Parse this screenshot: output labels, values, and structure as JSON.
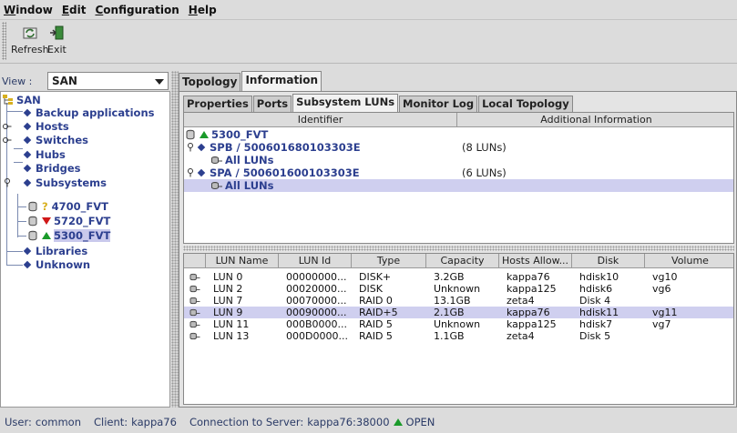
{
  "menu": {
    "items": [
      "Window",
      "Edit",
      "Configuration",
      "Help"
    ],
    "mnemonics": [
      "W",
      "E",
      "C",
      "H"
    ]
  },
  "toolbar": {
    "refresh_label": "Refresh",
    "exit_label": "Exit"
  },
  "view": {
    "label": "View :",
    "selected": "SAN"
  },
  "tree": {
    "root": "SAN",
    "items": [
      "Backup applications",
      "Hosts",
      "Switches",
      "Hubs",
      "Bridges",
      "Subsystems",
      "Libraries",
      "Unknown"
    ],
    "subsystems": [
      {
        "name": "4700_FVT",
        "status": "unknown"
      },
      {
        "name": "5720_FVT",
        "status": "down"
      },
      {
        "name": "5300_FVT",
        "status": "up"
      }
    ]
  },
  "outer_tabs": [
    "Topology",
    "Information"
  ],
  "inner_tabs": [
    "Properties",
    "Ports",
    "Subsystem LUNs",
    "Monitor Log",
    "Local Topology"
  ],
  "upper_table": {
    "headers": [
      "Identifier",
      "Additional Information"
    ],
    "subsystem": "5300_FVT",
    "controllers": [
      {
        "label": "SPB / 500601680103303E",
        "info": "(8 LUNs)",
        "child": "All LUNs"
      },
      {
        "label": "SPA / 500601600103303E",
        "info": "(6 LUNs)",
        "child": "All LUNs"
      }
    ]
  },
  "lun_table": {
    "headers": [
      "LUN Name",
      "LUN Id",
      "Type",
      "Capacity",
      "Hosts Allow...",
      "Disk",
      "Volume"
    ],
    "rows": [
      [
        "LUN 0",
        "00000000...",
        "DISK+",
        "3.2GB",
        "kappa76",
        "hdisk10",
        "vg10"
      ],
      [
        "LUN 2",
        "00020000...",
        "DISK",
        "Unknown",
        "kappa125",
        "hdisk6",
        "vg6"
      ],
      [
        "LUN 7",
        "00070000...",
        "RAID 0",
        "13.1GB",
        "zeta4",
        "Disk 4",
        ""
      ],
      [
        "LUN 9",
        "00090000...",
        "RAID+5",
        "2.1GB",
        "kappa76",
        "hdisk11",
        "vg11"
      ],
      [
        "LUN 11",
        "000B0000...",
        "RAID 5",
        "Unknown",
        "kappa125",
        "hdisk7",
        "vg7"
      ],
      [
        "LUN 13",
        "000D0000...",
        "RAID 5",
        "1.1GB",
        "zeta4",
        "Disk 5",
        ""
      ]
    ],
    "selected_row": 3
  },
  "status": {
    "user_label": "User:",
    "user": "common",
    "client_label": "Client:",
    "client": "kappa76",
    "conn_label": "Connection to Server:",
    "conn": "kappa76:38000",
    "conn_state": "OPEN"
  },
  "colors": {
    "tree_text": "#2c3f8f",
    "selection": "#cfcfef",
    "status_up": "#1a9a2a",
    "status_down": "#d01818"
  }
}
